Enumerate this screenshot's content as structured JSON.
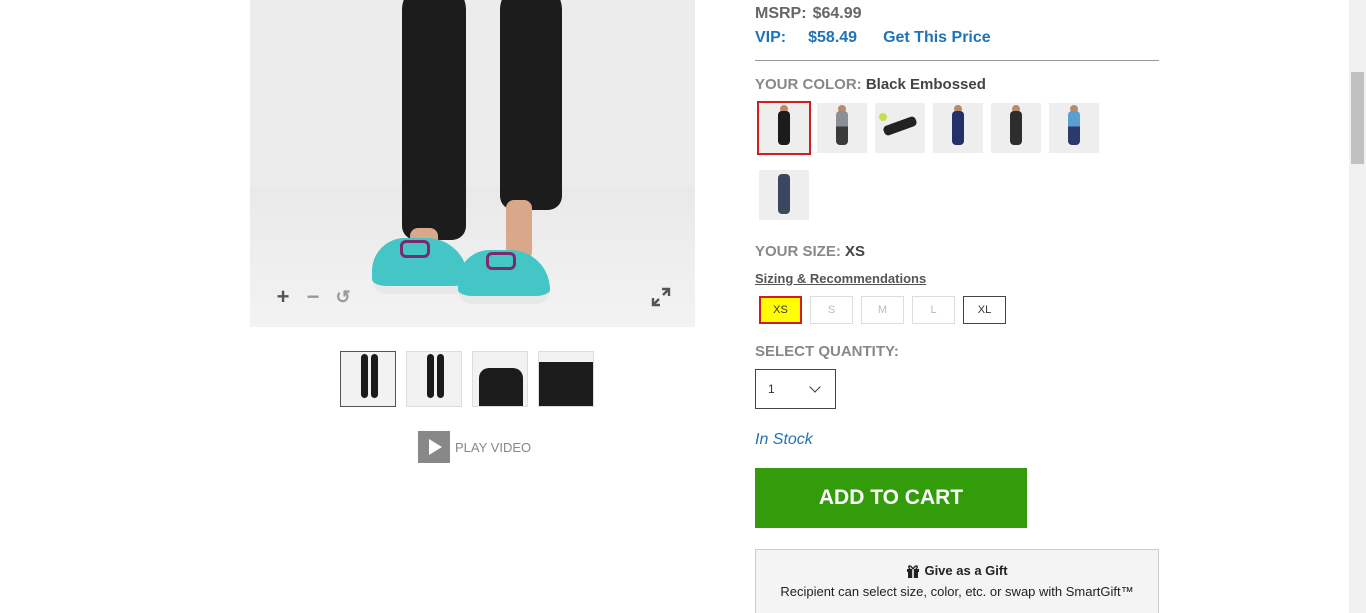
{
  "pricing": {
    "msrp_label": "MSRP:",
    "msrp_value": "$64.99",
    "vip_label": "VIP:",
    "vip_value": "$58.49",
    "vip_link": "Get This Price"
  },
  "color": {
    "label": "YOUR COLOR:",
    "selected": "Black Embossed",
    "swatch_icons": [
      "black-leggings",
      "grey-top-leggings",
      "yoga-pose-black",
      "navy-leggings",
      "charcoal-leggings",
      "blue-top-runner",
      "navy-print-leggings"
    ]
  },
  "size": {
    "label": "YOUR SIZE:",
    "selected": "XS",
    "sizing_link": "Sizing & Recommendations",
    "options": [
      "XS",
      "S",
      "M",
      "L",
      "XL"
    ]
  },
  "quantity": {
    "label": "SELECT QUANTITY:",
    "value": "1"
  },
  "stock_status": "In Stock",
  "add_to_cart_label": "ADD TO CART",
  "gift": {
    "title": "Give as a Gift",
    "description": "Recipient can select size, color, etc. or swap with SmartGift™"
  },
  "media": {
    "zoom_in_symbol": "+",
    "zoom_out_symbol": "−",
    "reset_symbol": "↺",
    "play_video_label": "PLAY VIDEO"
  },
  "colors": {
    "link_blue": "#1f73b7",
    "cart_green": "#339c0a",
    "selected_red": "#d01e1e",
    "selected_size_bg": "#ffff00"
  }
}
